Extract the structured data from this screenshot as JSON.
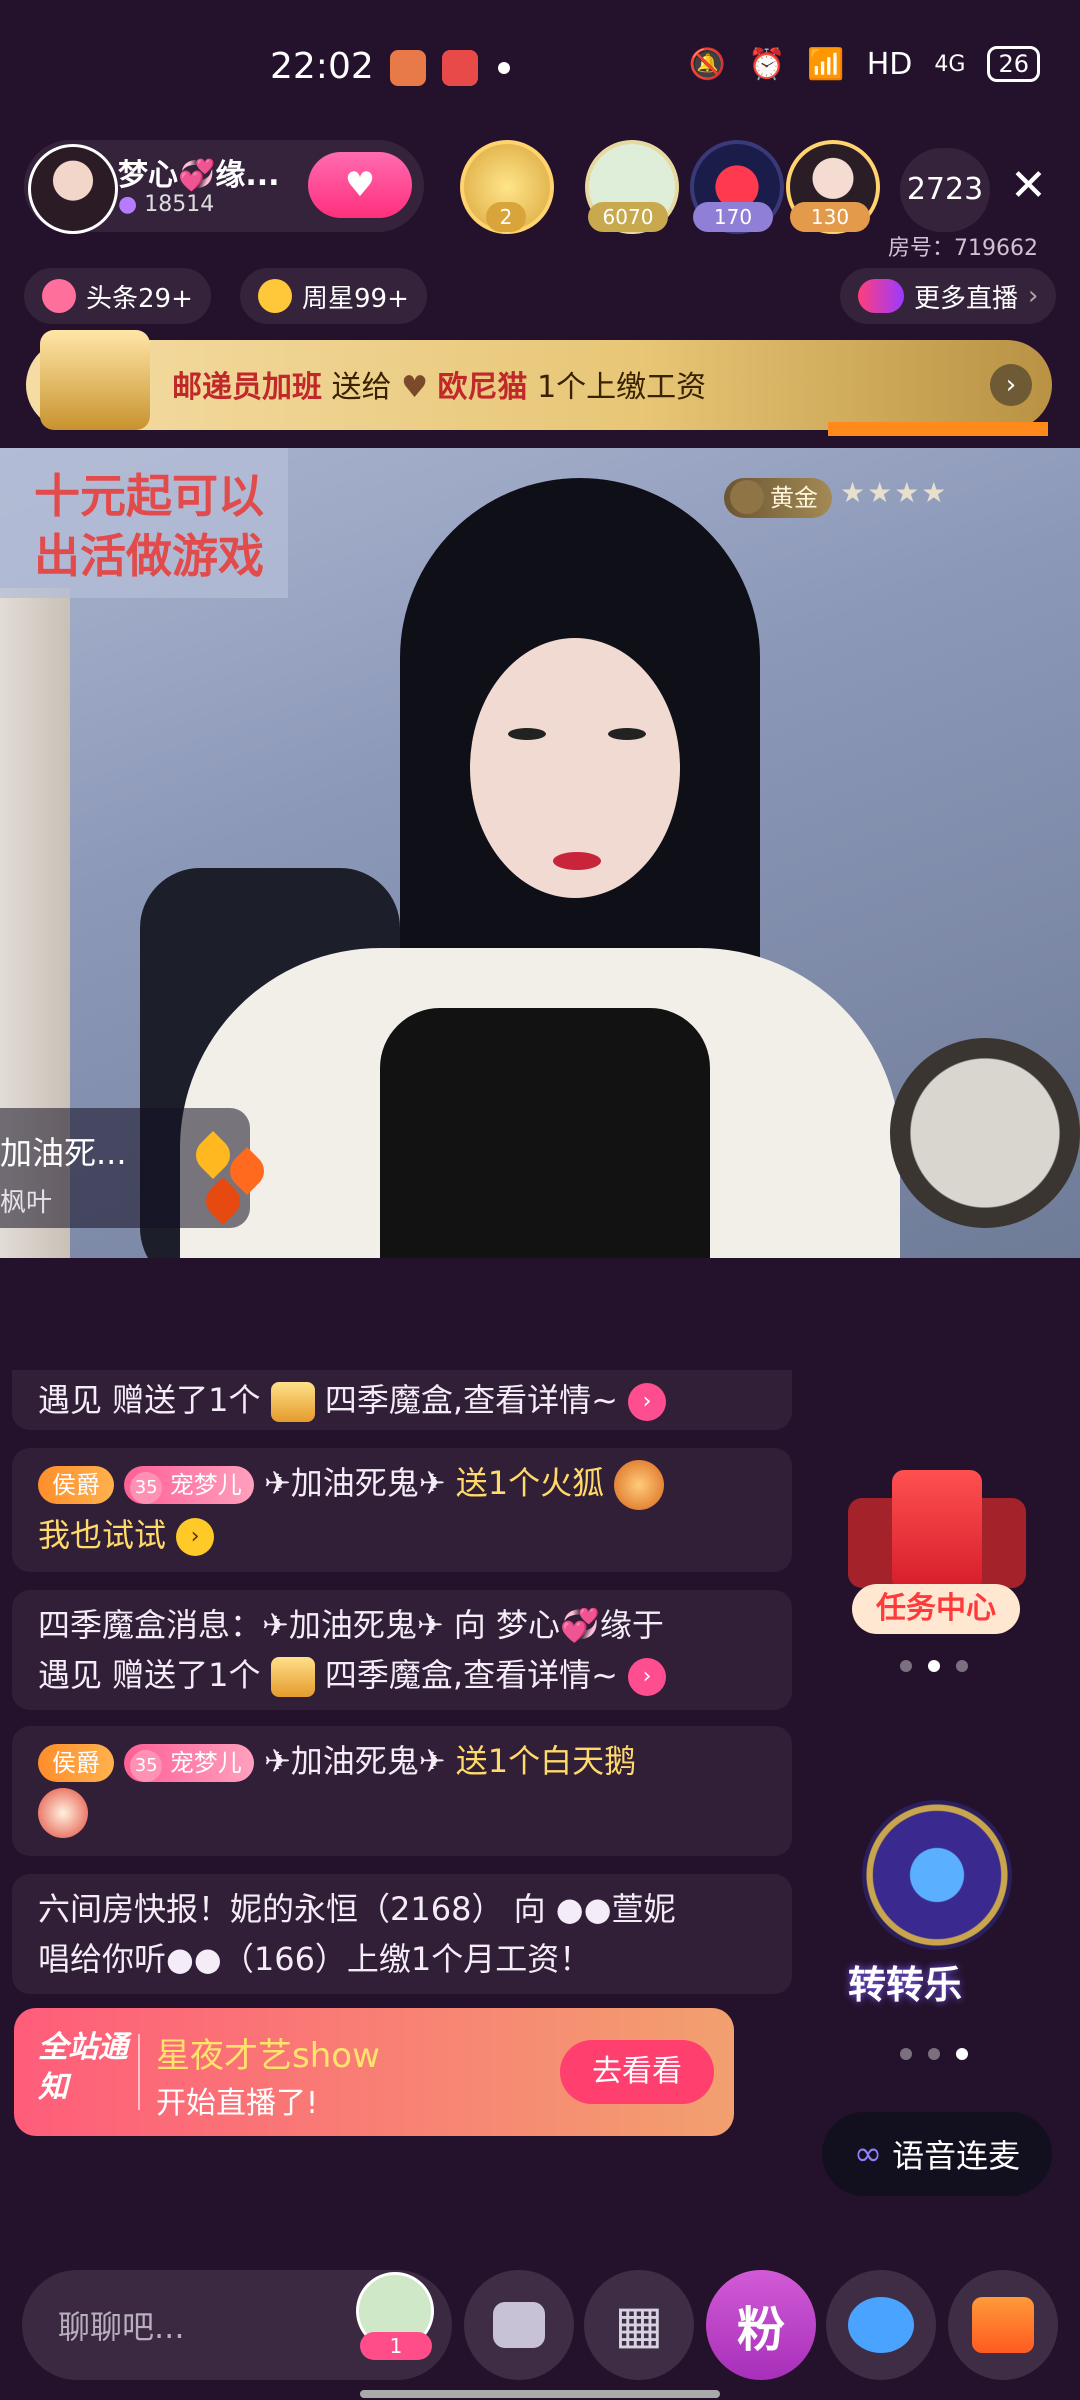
{
  "status_bar": {
    "time": "22:02",
    "network": "HD",
    "signal": "4G",
    "battery": "26"
  },
  "header": {
    "host_name": "梦心💞缘...",
    "host_followers": "18514",
    "viewers": [
      {
        "badge": "2",
        "color": "#d9a53b"
      },
      {
        "badge": "6070",
        "color": "#c9a94d"
      },
      {
        "badge": "170",
        "color": "#8f7fd6"
      },
      {
        "badge": "130",
        "color": "#e39a4a"
      }
    ],
    "online_count": "2723",
    "room_id": "房号：719662"
  },
  "tags": {
    "headline": "头条29+",
    "weekly_star": "周星99+",
    "more_live": "更多直播"
  },
  "banner": {
    "part1": "邮递员加班",
    "part2": "送给",
    "part3": "欧尼猫",
    "part4": "1个上缴工资"
  },
  "video": {
    "promo_line1": "十元起可以",
    "promo_line2": "出活做游戏",
    "rank_label": "黄金",
    "stars": "★★★★",
    "gift_name": "加油死...",
    "gift_sub": "枫叶"
  },
  "chat": {
    "msg1": {
      "prefix": "遇见 赠送了1个",
      "suffix": "四季魔盒,查看详情~"
    },
    "msg2": {
      "rank": "侯爵",
      "pet_level": "35",
      "pet": "宠梦儿",
      "user": "✈加油死鬼✈",
      "action": "送1个火狐",
      "line2": "我也试试"
    },
    "msg3": {
      "line1": "四季魔盒消息：✈加油死鬼✈ 向 梦心💞缘于",
      "line2_prefix": "遇见 赠送了1个",
      "line2_suffix": "四季魔盒,查看详情~"
    },
    "msg4": {
      "rank": "侯爵",
      "pet_level": "35",
      "pet": "宠梦儿",
      "user": "✈加油死鬼✈",
      "action": "送1个白天鹅"
    },
    "msg5": {
      "line1": "六间房快报！妮的永恒（2168） 向 ●●萱妮",
      "line2": "唱给你听●●（166）上缴1个月工资！"
    }
  },
  "notice": {
    "tag": "全站通知",
    "title": "星夜才艺show",
    "sub": "开始直播了!",
    "button": "去看看"
  },
  "widgets": {
    "task_center": "任务中心",
    "wheel": "转转乐",
    "voice": "语音连麦"
  },
  "bottom": {
    "chat_placeholder": "聊聊吧...",
    "fan_count": "1",
    "fan_label": "粉"
  }
}
